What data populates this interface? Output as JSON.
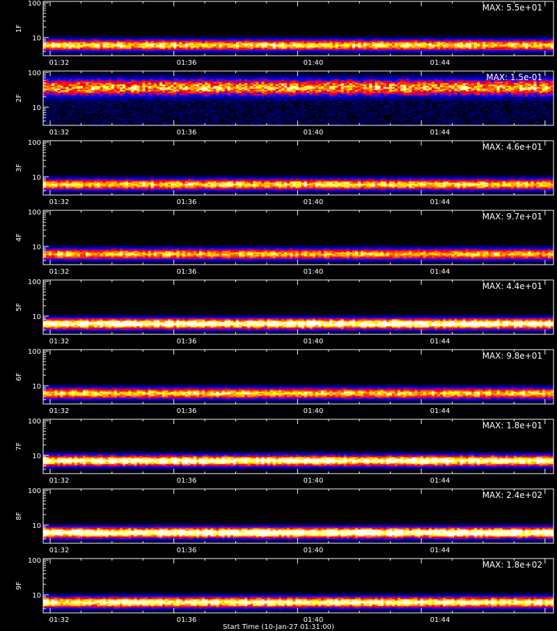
{
  "chart_data": {
    "type": "heatmap",
    "x_tick_labels": [
      "01:32",
      "01:36",
      "01:40",
      "01:44"
    ],
    "y_tick_labels": [
      "100",
      "10"
    ],
    "yscale": "log",
    "ylim": [
      3,
      110
    ],
    "colormap": [
      "#000000",
      "#00007f",
      "#0000ff",
      "#c00080",
      "#ff0000",
      "#ff8000",
      "#ffff00",
      "#ffffff"
    ],
    "footer": "Start Time (10-Jan-27 01:31:00)",
    "panels": [
      {
        "ylabel": "1F",
        "max_label": "MAX: 5.5e+01",
        "band_center": 6.0,
        "intensity": 0.72
      },
      {
        "ylabel": "2F",
        "max_label": "MAX: 1.5e-01",
        "band_center": 38.0,
        "intensity": 0.62
      },
      {
        "ylabel": "3F",
        "max_label": "MAX: 4.6e+01",
        "band_center": 6.0,
        "intensity": 0.72
      },
      {
        "ylabel": "4F",
        "max_label": "MAX: 9.7e+01",
        "band_center": 6.0,
        "intensity": 0.68
      },
      {
        "ylabel": "5F",
        "max_label": "MAX: 4.4e+01",
        "band_center": 6.0,
        "intensity": 0.88
      },
      {
        "ylabel": "6F",
        "max_label": "MAX: 9.8e+01",
        "band_center": 6.0,
        "intensity": 0.7
      },
      {
        "ylabel": "7F",
        "max_label": "MAX: 1.8e+01",
        "band_center": 7.0,
        "intensity": 0.85
      },
      {
        "ylabel": "8F",
        "max_label": "MAX: 2.4e+02",
        "band_center": 6.0,
        "intensity": 0.92
      },
      {
        "ylabel": "9F",
        "max_label": "MAX: 1.8e+02",
        "band_center": 6.0,
        "intensity": 0.82
      }
    ]
  }
}
